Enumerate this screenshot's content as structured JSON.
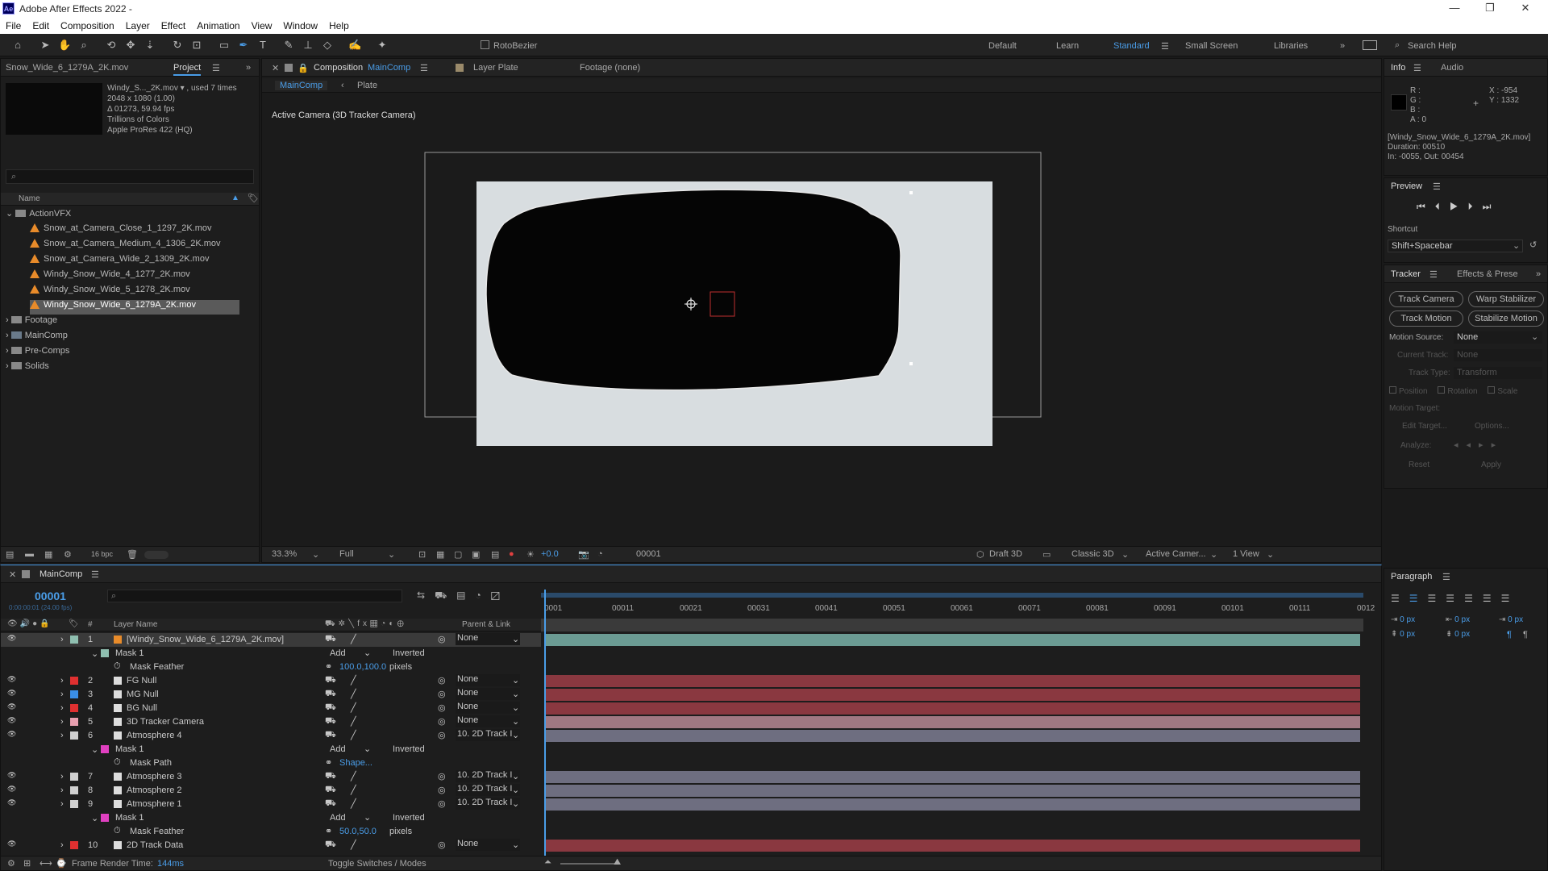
{
  "app": {
    "title": "Adobe After Effects 2022 -",
    "logo": "Ae"
  },
  "window_controls": {
    "minimize": "—",
    "restore": "❐",
    "close": "✕"
  },
  "menu": [
    "File",
    "Edit",
    "Composition",
    "Layer",
    "Effect",
    "Animation",
    "View",
    "Window",
    "Help"
  ],
  "toolbar": {
    "rotobrush": "RotoBezier",
    "workspaces": [
      "Default",
      "Learn",
      "Standard",
      "Small Screen",
      "Libraries"
    ],
    "active_workspace": "Standard",
    "search_placeholder": "Search Help"
  },
  "project": {
    "header_file": "Snow_Wide_6_1279A_2K.mov",
    "tab": "Project",
    "thumb": {
      "name": "Windy_S..._2K.mov ▾ , used 7 times",
      "res": "2048 x 1080 (1.00)",
      "duration": "Δ 01273, 59.94 fps",
      "colors": "Trillions of Colors",
      "codec": "Apple ProRes 422 (HQ)"
    },
    "search_placeholder": "",
    "col_name": "Name",
    "items": [
      {
        "label": "ActionVFX",
        "type": "folder",
        "indent": 0,
        "open": true
      },
      {
        "label": "Snow_at_Camera_Close_1_1297_2K.mov",
        "type": "clip",
        "indent": 1
      },
      {
        "label": "Snow_at_Camera_Medium_4_1306_2K.mov",
        "type": "clip",
        "indent": 1
      },
      {
        "label": "Snow_at_Camera_Wide_2_1309_2K.mov",
        "type": "clip",
        "indent": 1
      },
      {
        "label": "Windy_Snow_Wide_4_1277_2K.mov",
        "type": "clip",
        "indent": 1
      },
      {
        "label": "Windy_Snow_Wide_5_1278_2K.mov",
        "type": "clip",
        "indent": 1
      },
      {
        "label": "Windy_Snow_Wide_6_1279A_2K.mov",
        "type": "clip",
        "indent": 1,
        "selected": true
      },
      {
        "label": "Footage",
        "type": "folder",
        "indent": 0
      },
      {
        "label": "MainComp",
        "type": "comp",
        "indent": 0
      },
      {
        "label": "Pre-Comps",
        "type": "folder",
        "indent": 0
      },
      {
        "label": "Solids",
        "type": "folder",
        "indent": 0
      }
    ],
    "bpc": "16 bpc"
  },
  "viewer": {
    "tab_comp_prefix": "Composition",
    "tab_comp_name": "MainComp",
    "tab_layer": "Layer Plate",
    "tab_footage": "Footage (none)",
    "breadcrumb": [
      "MainComp",
      "Plate"
    ],
    "camera_label": "Active Camera (3D Tracker Camera)",
    "zoom": "33.3%",
    "quality": "Full",
    "exposure": "+0.0",
    "frame": "00001",
    "draft": "Draft 3D",
    "renderer": "Classic 3D",
    "camera": "Active Camer...",
    "views": "1 View"
  },
  "info": {
    "tabs": [
      "Info",
      "Audio"
    ],
    "r": "R :",
    "g": "G :",
    "b": "B :",
    "a": "A :  0",
    "x": "X : -954",
    "y": "Y : 1332",
    "file": "[Windy_Snow_Wide_6_1279A_2K.mov]",
    "duration": "Duration: 00510",
    "inout": "In: -0055, Out: 00454"
  },
  "preview": {
    "title": "Preview",
    "shortcut_label": "Shortcut",
    "shortcut": "Shift+Spacebar"
  },
  "tracker": {
    "tabs": [
      "Tracker",
      "Effects & Prese"
    ],
    "buttons": [
      "Track Camera",
      "Warp Stabilizer",
      "Track Motion",
      "Stabilize Motion"
    ],
    "motion_source_label": "Motion Source:",
    "motion_source": "None",
    "current_track_label": "Current Track:",
    "current_track": "None",
    "track_type_label": "Track Type:",
    "track_type": "Transform",
    "opts": [
      "Position",
      "Rotation",
      "Scale"
    ],
    "motion_target": "Motion Target:",
    "edit_target": "Edit Target...",
    "options": "Options...",
    "analyze": "Analyze:",
    "reset": "Reset",
    "apply": "Apply"
  },
  "paragraph": {
    "title": "Paragraph",
    "vals": [
      "0 px",
      "0 px",
      "0 px",
      "0 px",
      "0 px"
    ]
  },
  "timeline": {
    "tab": "MainComp",
    "timecode": "00001",
    "timecode_sub": "0:00:00:01 (24.00 fps)",
    "col_layer": "Layer Name",
    "col_parent": "Parent & Link",
    "ruler": [
      "0001",
      "00011",
      "00021",
      "00031",
      "00041",
      "00051",
      "00061",
      "00071",
      "00081",
      "00091",
      "00101",
      "00111",
      "0012"
    ],
    "rows": [
      {
        "kind": "layer",
        "num": "1",
        "name": "[Windy_Snow_Wide_6_1279A_2K.mov]",
        "color": "#8fbfb0",
        "parent": "None",
        "bar": "#6b9b93",
        "sel": true,
        "icon": "cone"
      },
      {
        "kind": "mask",
        "name": "Mask 1",
        "mode": "Add",
        "inv": "Inverted",
        "color": "#8fbfb0"
      },
      {
        "kind": "prop",
        "name": "Mask Feather",
        "val": "100.0,100.0",
        "unit": "pixels"
      },
      {
        "kind": "layer",
        "num": "2",
        "name": "FG Null",
        "color": "#e03030",
        "parent": "None",
        "bar": "#8a3840"
      },
      {
        "kind": "layer",
        "num": "3",
        "name": "MG Null",
        "color": "#3a8ee6",
        "parent": "None",
        "bar": "#8a3840"
      },
      {
        "kind": "layer",
        "num": "4",
        "name": "BG Null",
        "color": "#e03030",
        "parent": "None",
        "bar": "#8a3840"
      },
      {
        "kind": "layer",
        "num": "5",
        "name": "3D Tracker Camera",
        "color": "#e8a0b0",
        "parent": "None",
        "bar": "#a07882",
        "icon": "cam"
      },
      {
        "kind": "layer",
        "num": "6",
        "name": "Atmosphere 4",
        "color": "#d0d0d0",
        "parent": "10. 2D Track I",
        "bar": "#6e6e80"
      },
      {
        "kind": "mask",
        "name": "Mask 1",
        "mode": "Add",
        "inv": "Inverted",
        "color": "#e040c0"
      },
      {
        "kind": "prop",
        "name": "Mask Path",
        "val": "Shape...",
        "unit": ""
      },
      {
        "kind": "layer",
        "num": "7",
        "name": "Atmosphere 3",
        "color": "#d0d0d0",
        "parent": "10. 2D Track I",
        "bar": "#6e6e80"
      },
      {
        "kind": "layer",
        "num": "8",
        "name": "Atmosphere 2",
        "color": "#d0d0d0",
        "parent": "10. 2D Track I",
        "bar": "#6e6e80"
      },
      {
        "kind": "layer",
        "num": "9",
        "name": "Atmosphere 1",
        "color": "#d0d0d0",
        "parent": "10. 2D Track I",
        "bar": "#6e6e80"
      },
      {
        "kind": "mask",
        "name": "Mask 1",
        "mode": "Add",
        "inv": "Inverted",
        "color": "#e040c0"
      },
      {
        "kind": "prop",
        "name": "Mask Feather",
        "val": "50.0,50.0",
        "unit": "pixels"
      },
      {
        "kind": "layer",
        "num": "10",
        "name": "2D Track Data",
        "color": "#e03030",
        "parent": "None",
        "bar": "#8a3840"
      }
    ],
    "render_time_label": "Frame Render Time:",
    "render_time": "144ms",
    "toggle": "Toggle Switches / Modes"
  },
  "colors": {
    "accent": "#4a9de8",
    "bg": "#1d1d1d"
  }
}
